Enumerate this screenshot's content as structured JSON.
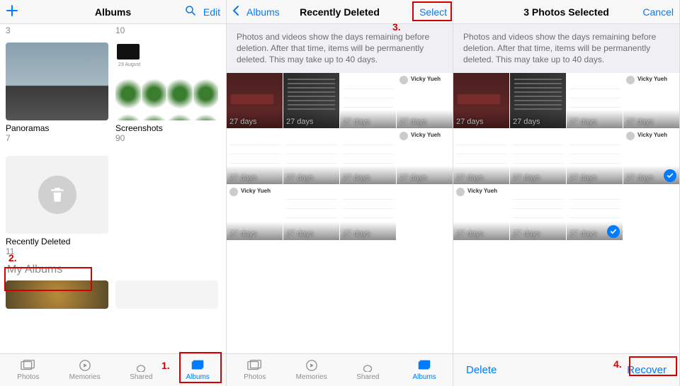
{
  "pane1": {
    "nav": {
      "title": "Albums",
      "edit": "Edit"
    },
    "albums": {
      "top": [
        {
          "name": "",
          "count": "3"
        },
        {
          "name": "",
          "count": "10"
        }
      ],
      "mid": [
        {
          "name": "Panoramas",
          "count": "7"
        },
        {
          "name": "Screenshots",
          "count": "90"
        }
      ],
      "recentlyDeleted": {
        "name": "Recently Deleted",
        "count": "11"
      },
      "myAlbumsHeader": "My Albums"
    },
    "tabs": {
      "photos": "Photos",
      "memories": "Memories",
      "shared": "Shared",
      "albums": "Albums"
    },
    "screenshotDate": "23 August"
  },
  "pane2": {
    "nav": {
      "back": "Albums",
      "title": "Recently Deleted",
      "select": "Select"
    },
    "info": "Photos and videos show the days remaining before deletion. After that time, items will be permanently deleted. This may take up to 40 days.",
    "daysLabel": "27 days",
    "thumbVariants": [
      "bday",
      "darktext",
      "settings",
      "vicky",
      "toggles",
      "toggles",
      "settings",
      "vicky",
      "vicky",
      "list2",
      "list2"
    ],
    "tabs": {
      "photos": "Photos",
      "memories": "Memories",
      "shared": "Shared",
      "albums": "Albums"
    },
    "vickyName": "Vicky Yueh"
  },
  "pane3": {
    "nav": {
      "title": "3 Photos Selected",
      "cancel": "Cancel"
    },
    "info": "Photos and videos show the days remaining before deletion. After that time, items will be permanently deleted. This may take up to 40 days.",
    "daysLabel": "27 days",
    "thumbVariants": [
      "bday",
      "darktext",
      "settings",
      "vicky",
      "toggles",
      "toggles",
      "settings",
      "vicky",
      "vicky",
      "list2",
      "list2"
    ],
    "selected": [
      7,
      10
    ],
    "toolbar": {
      "delete": "Delete",
      "recover": "Recover"
    },
    "vickyName": "Vicky Yueh"
  },
  "annotations": {
    "a1": "1.",
    "a2": "2.",
    "a3": "3.",
    "a4": "4."
  }
}
